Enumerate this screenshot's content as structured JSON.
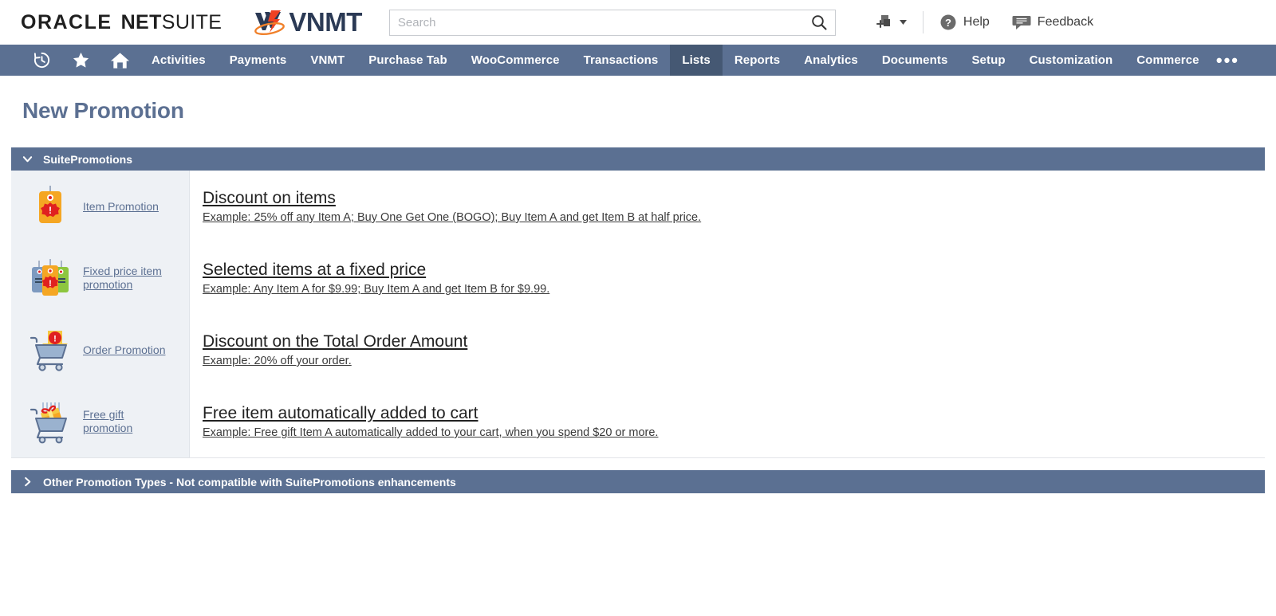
{
  "topbar": {
    "oracle_logo": {
      "oracle": "ORACLE",
      "net": "NET",
      "suite": "SUITE"
    },
    "vnmt_logo_text": "VNMT",
    "search": {
      "placeholder": "Search",
      "value": ""
    },
    "help_label": "Help",
    "feedback_label": "Feedback",
    "create_new_label": ""
  },
  "nav": {
    "icons": [
      {
        "name": "recent-history-icon"
      },
      {
        "name": "favorites-star-icon"
      },
      {
        "name": "home-icon"
      }
    ],
    "items": [
      {
        "label": "Activities",
        "active": false
      },
      {
        "label": "Payments",
        "active": false
      },
      {
        "label": "VNMT",
        "active": false
      },
      {
        "label": "Purchase Tab",
        "active": false
      },
      {
        "label": "WooCommerce",
        "active": false
      },
      {
        "label": "Transactions",
        "active": false
      },
      {
        "label": "Lists",
        "active": true
      },
      {
        "label": "Reports",
        "active": false
      },
      {
        "label": "Analytics",
        "active": false
      },
      {
        "label": "Documents",
        "active": false
      },
      {
        "label": "Setup",
        "active": false
      },
      {
        "label": "Customization",
        "active": false
      },
      {
        "label": "Commerce",
        "active": false
      }
    ],
    "overflow_label": "•••"
  },
  "page": {
    "title": "New Promotion",
    "suitepromotions_header": "SuitePromotions",
    "other_types_header": "Other Promotion Types - Not compatible with SuitePromotions enhancements"
  },
  "promotions": [
    {
      "icon": "price-tag-icon",
      "side_label": "Item Promotion",
      "title": "Discount on items",
      "example": "Example: 25% off any Item A; Buy One Get One (BOGO); Buy Item A and get Item B at half price."
    },
    {
      "icon": "multi-price-tag-icon",
      "side_label": "Fixed price item promotion",
      "title": "Selected items at a fixed price",
      "example": "Example: Any Item A for $9.99; Buy Item A and get Item B for $9.99."
    },
    {
      "icon": "cart-discount-icon",
      "side_label": "Order Promotion",
      "title": "Discount on the Total Order Amount",
      "example": "Example: 20% off your order."
    },
    {
      "icon": "cart-gift-icon",
      "side_label": "Free gift promotion",
      "title": "Free item automatically added to cart",
      "example": "Example: Free gift Item A automatically added to your cart, when you spend $20 or more."
    }
  ],
  "colors": {
    "nav_bg": "#5b7092",
    "nav_active": "#455873",
    "title_color": "#5c7092",
    "sidebar_bg": "#eef1f5",
    "tag_yellow": "#f5a623",
    "badge_red": "#e02020",
    "cart_blue": "#7d9ac0"
  }
}
